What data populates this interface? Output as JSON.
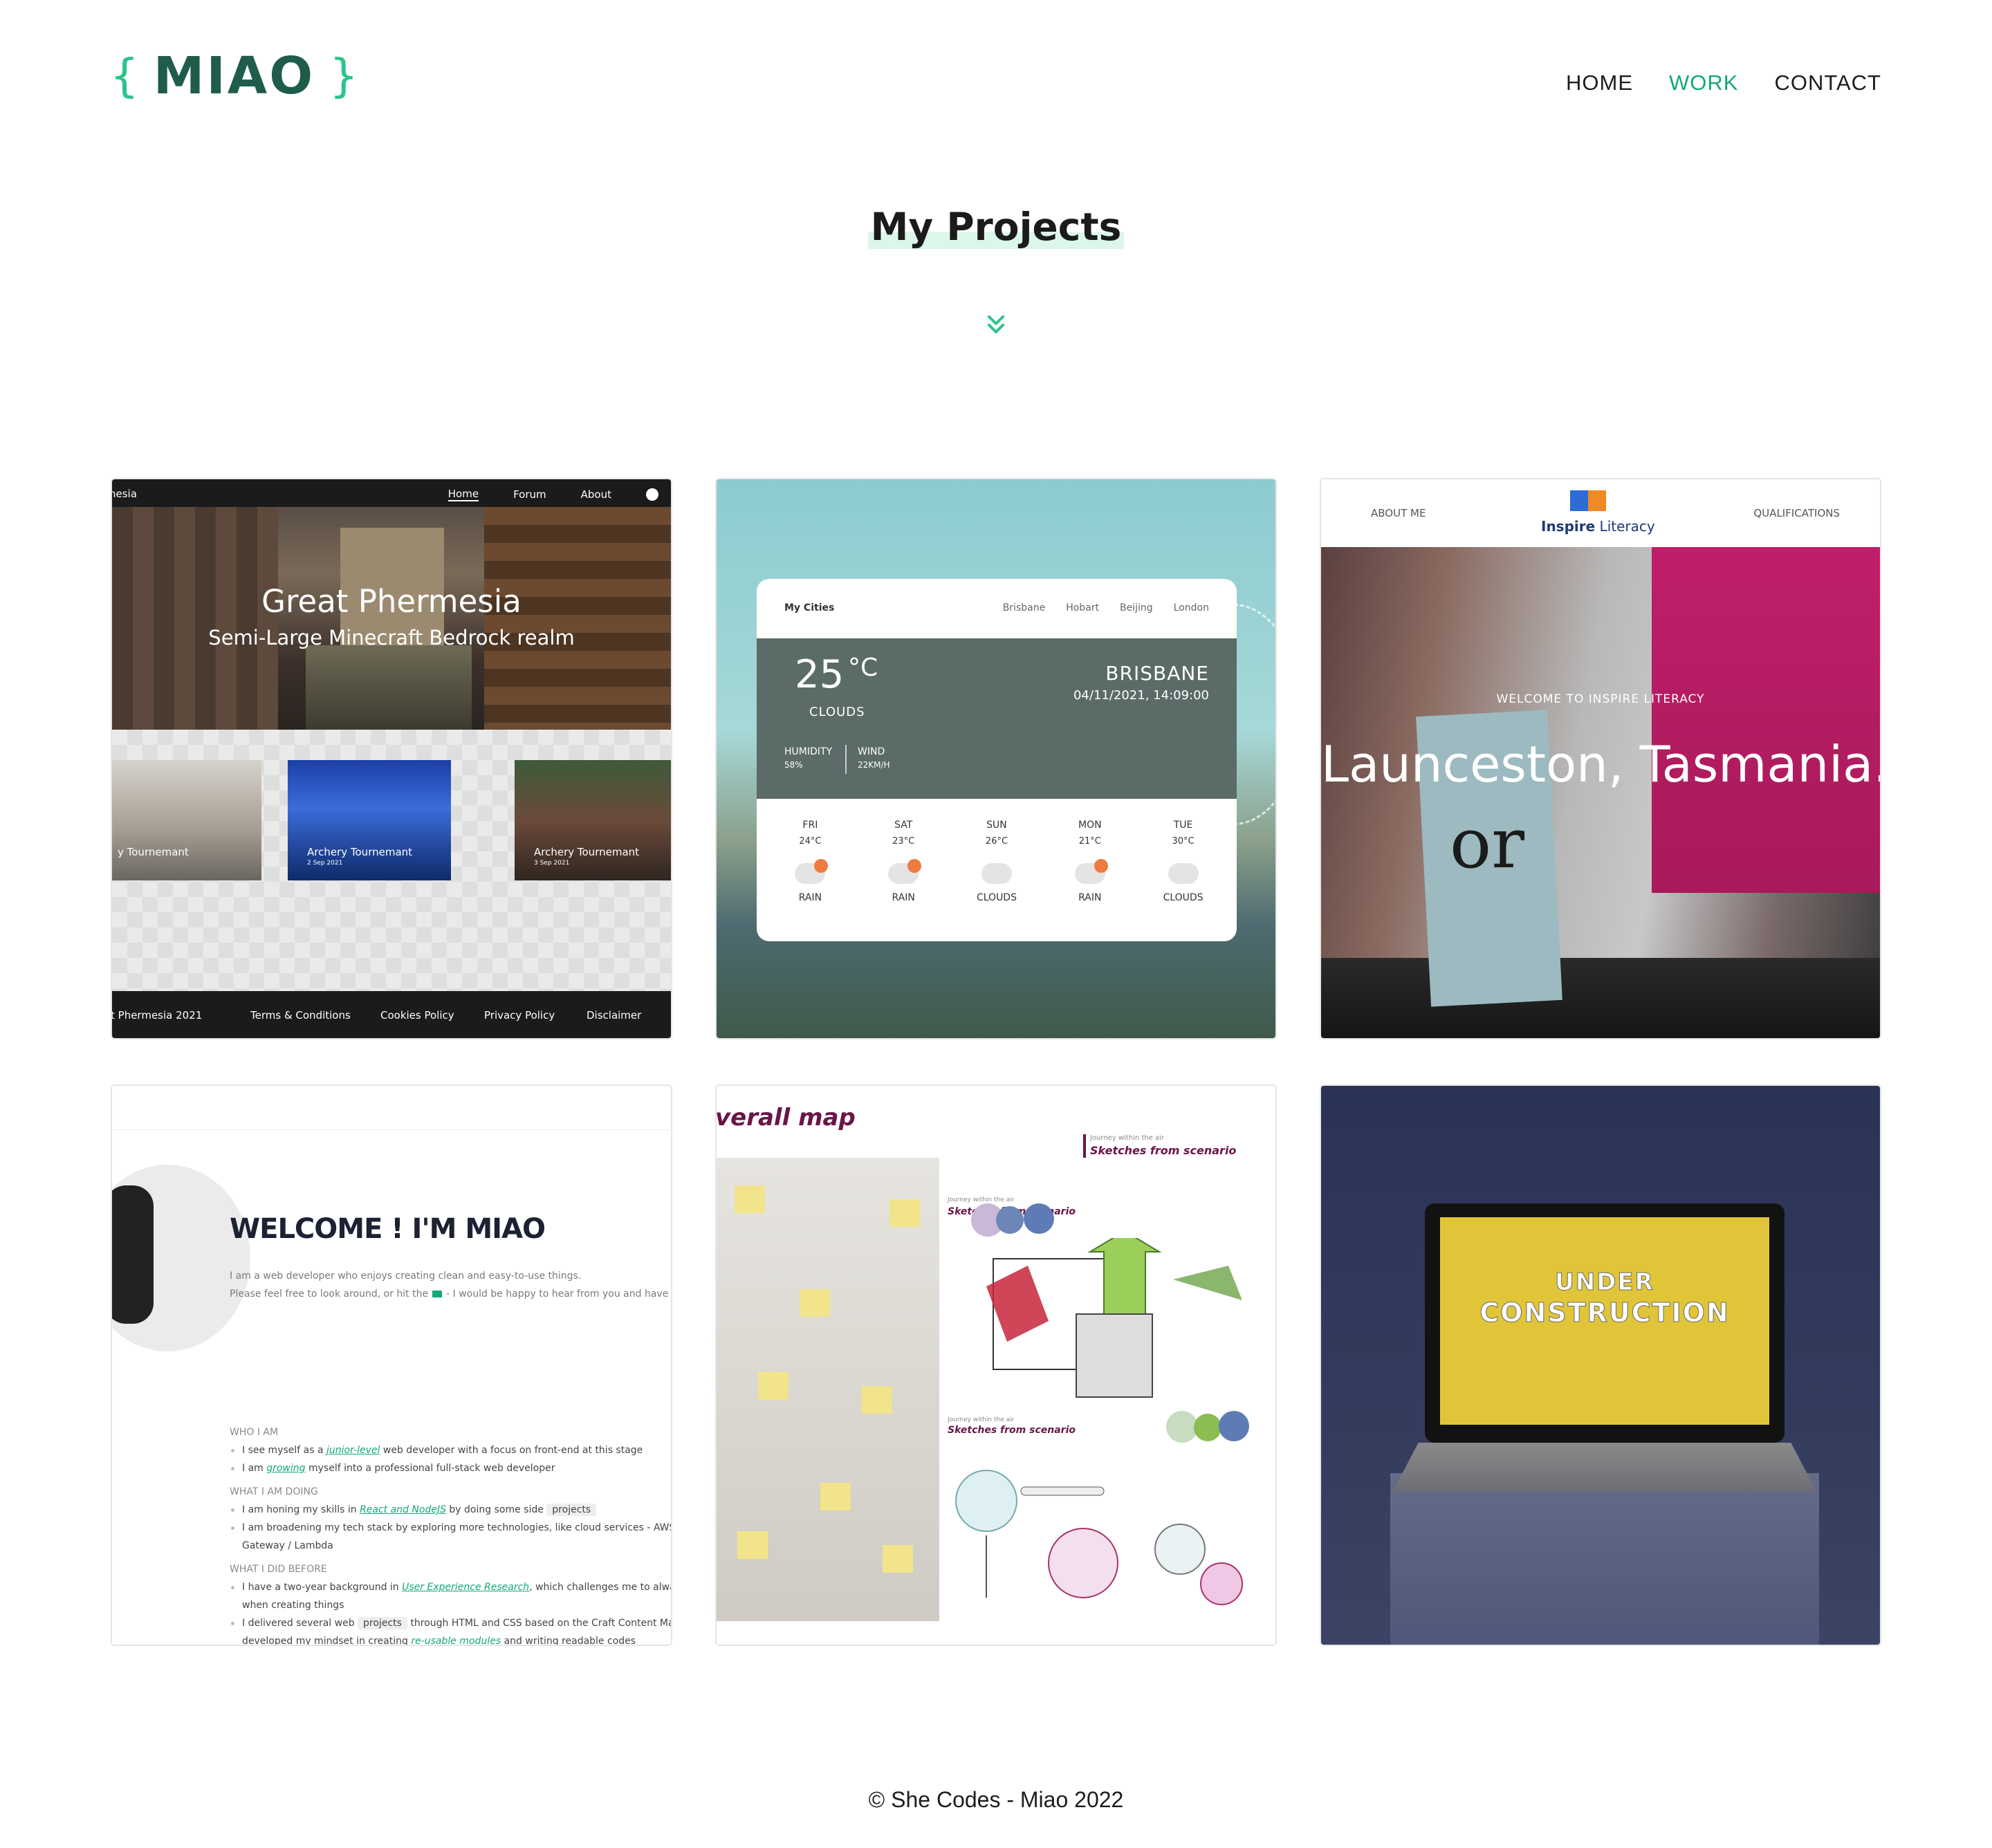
{
  "header": {
    "logo_brace_open": "{",
    "logo_text": "MIAO",
    "logo_brace_close": "}",
    "nav": [
      {
        "label": "HOME",
        "active": false
      },
      {
        "label": "WORK",
        "active": true
      },
      {
        "label": "CONTACT",
        "active": false
      }
    ]
  },
  "title": "My Projects",
  "projects": {
    "phermesia": {
      "nav_brand": "nesia",
      "nav_links": [
        "Home",
        "Forum",
        "About"
      ],
      "hero_title": "Great Phermesia",
      "hero_subtitle": "Semi-Large Minecraft Bedrock realm",
      "tiles": [
        {
          "caption": "y Tournemant",
          "date": ""
        },
        {
          "caption": "Archery Tournemant",
          "date": "2 Sep 2021"
        },
        {
          "caption": "Archery Tournemant",
          "date": "3 Sep 2021"
        }
      ],
      "footer": [
        "t Phermesia 2021",
        "Terms & Conditions",
        "Cookies Policy",
        "Privacy Policy",
        "Disclaimer"
      ]
    },
    "weather": {
      "my_cities": "My Cities",
      "cities": [
        "Brisbane",
        "Hobart",
        "Beijing",
        "London"
      ],
      "temp": "25",
      "unit": "°C",
      "desc": "CLOUDS",
      "city": "BRISBANE",
      "datetime": "04/11/2021, 14:09:00",
      "humidity_label": "HUMIDITY",
      "humidity_val": "58%",
      "wind_label": "WIND",
      "wind_val": "22KM/H",
      "days": [
        {
          "day": "FRI",
          "temp": "24°C",
          "cond": "RAIN",
          "icon": "rain-icon"
        },
        {
          "day": "SAT",
          "temp": "23°C",
          "cond": "RAIN",
          "icon": "rain-icon"
        },
        {
          "day": "SUN",
          "temp": "26°C",
          "cond": "CLOUDS",
          "icon": "cloud-icon"
        },
        {
          "day": "MON",
          "temp": "21°C",
          "cond": "RAIN",
          "icon": "rain-icon"
        },
        {
          "day": "TUE",
          "temp": "30°C",
          "cond": "CLOUDS",
          "icon": "cloud-icon"
        }
      ]
    },
    "inspire": {
      "about": "ABOUT ME",
      "logo_bold": "Inspire",
      "logo_light": "Literacy",
      "qualifications": "QUALIFICATIONS",
      "welcome": "WELCOME TO INSPIRE LITERACY",
      "location": "Launceston, Tasmania.",
      "book_text": "or"
    },
    "welcome": {
      "heading": "WELCOME ! I'M MIAO",
      "intro1": "I am a web developer who enjoys creating clean and easy-to-use things.",
      "intro2a": "Please feel free to look around, or hit the",
      "intro2b": "- I would be happy to hear from you and have a cha",
      "sec1": "WHO I AM",
      "s1a_pre": "I see myself as a ",
      "s1a_hl": "junior-level",
      "s1a_post": " web developer with a focus on front-end at this stage",
      "s1b_pre": "I am ",
      "s1b_hl": "growing",
      "s1b_post": " myself into a professional full-stack web developer",
      "sec2": "WHAT I AM DOING",
      "s2a_pre": "I am honing my skills in ",
      "s2a_hl": "React and NodeJS",
      "s2a_mid": " by doing some side ",
      "s2a_tag": "projects",
      "s2b": "I am broadening my tech stack by exploring more technologies, like cloud services - AWS A",
      "s2b2": "Gateway / Lambda",
      "sec3": "WHAT I DID BEFORE",
      "s3a_pre": "I have a two-year background in ",
      "s3a_hl": "User Experience Research",
      "s3a_post": ", which challenges me to alway",
      "s3a2": "when creating things",
      "s3b_pre": "I delivered several web ",
      "s3b_tag": "projects",
      "s3b_post": " through HTML and CSS based on the Craft Content Mana",
      "s3b2_pre": "developed my mindset in creating ",
      "s3b2_hl": "re-usable modules",
      "s3b2_post": " and writing readable codes"
    },
    "sketches": {
      "heading": "verall map",
      "s1_small": "Journey within the air",
      "s1_big": "Sketches from scenario",
      "s2_small": "Journey within the air",
      "s2_big": "Sketches from scenario",
      "s3_small": "Journey within the air",
      "s3_big": "Sketches from scenario"
    },
    "construction": {
      "line1": "UNDER",
      "line2": "CONSTRUCTION"
    }
  },
  "footer": "© She Codes - Miao 2022",
  "colors": {
    "accent": "#12a87a",
    "logo_dark": "#1f5c4c",
    "logo_brace": "#2cc48a"
  }
}
